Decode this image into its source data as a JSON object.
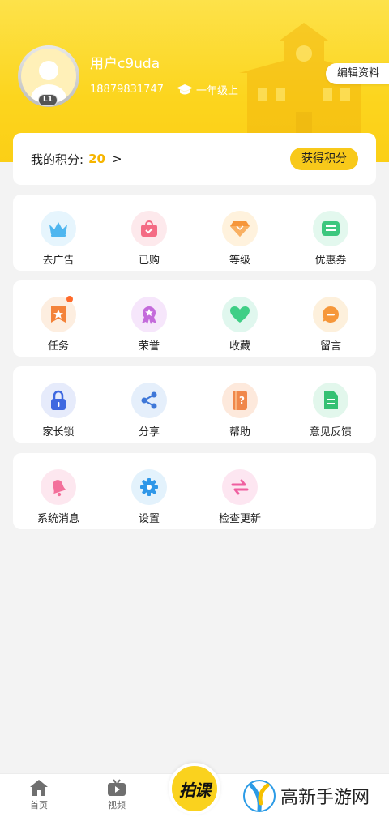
{
  "profile": {
    "username": "用户c9uda",
    "phone": "18879831747",
    "grade": "一年级上",
    "level": "L1",
    "edit_label": "编辑资料"
  },
  "points": {
    "label": "我的积分:",
    "value": "20",
    "arrow": ">",
    "earn_label": "获得积分"
  },
  "menu": {
    "row1": [
      {
        "label": "去广告",
        "icon": "crown-icon"
      },
      {
        "label": "已购",
        "icon": "shopping-bag-icon"
      },
      {
        "label": "等级",
        "icon": "diamond-icon"
      },
      {
        "label": "优惠券",
        "icon": "coupon-icon"
      }
    ],
    "row2": [
      {
        "label": "任务",
        "icon": "task-icon"
      },
      {
        "label": "荣誉",
        "icon": "medal-icon"
      },
      {
        "label": "收藏",
        "icon": "heart-icon"
      },
      {
        "label": "留言",
        "icon": "message-icon"
      }
    ],
    "row3": [
      {
        "label": "家长锁",
        "icon": "lock-icon"
      },
      {
        "label": "分享",
        "icon": "share-icon"
      },
      {
        "label": "帮助",
        "icon": "help-icon"
      },
      {
        "label": "意见反馈",
        "icon": "feedback-icon"
      }
    ],
    "row4": [
      {
        "label": "系统消息",
        "icon": "bell-icon"
      },
      {
        "label": "设置",
        "icon": "gear-icon"
      },
      {
        "label": "检查更新",
        "icon": "refresh-icon"
      }
    ]
  },
  "tabbar": {
    "home_label": "首页",
    "video_label": "视频",
    "center_label": "拍课"
  },
  "watermark": {
    "text": "高新手游网"
  },
  "colors": {
    "accent": "#f8c91a",
    "points_value": "#f6b500",
    "badge_dot": "#ff6a2a"
  }
}
